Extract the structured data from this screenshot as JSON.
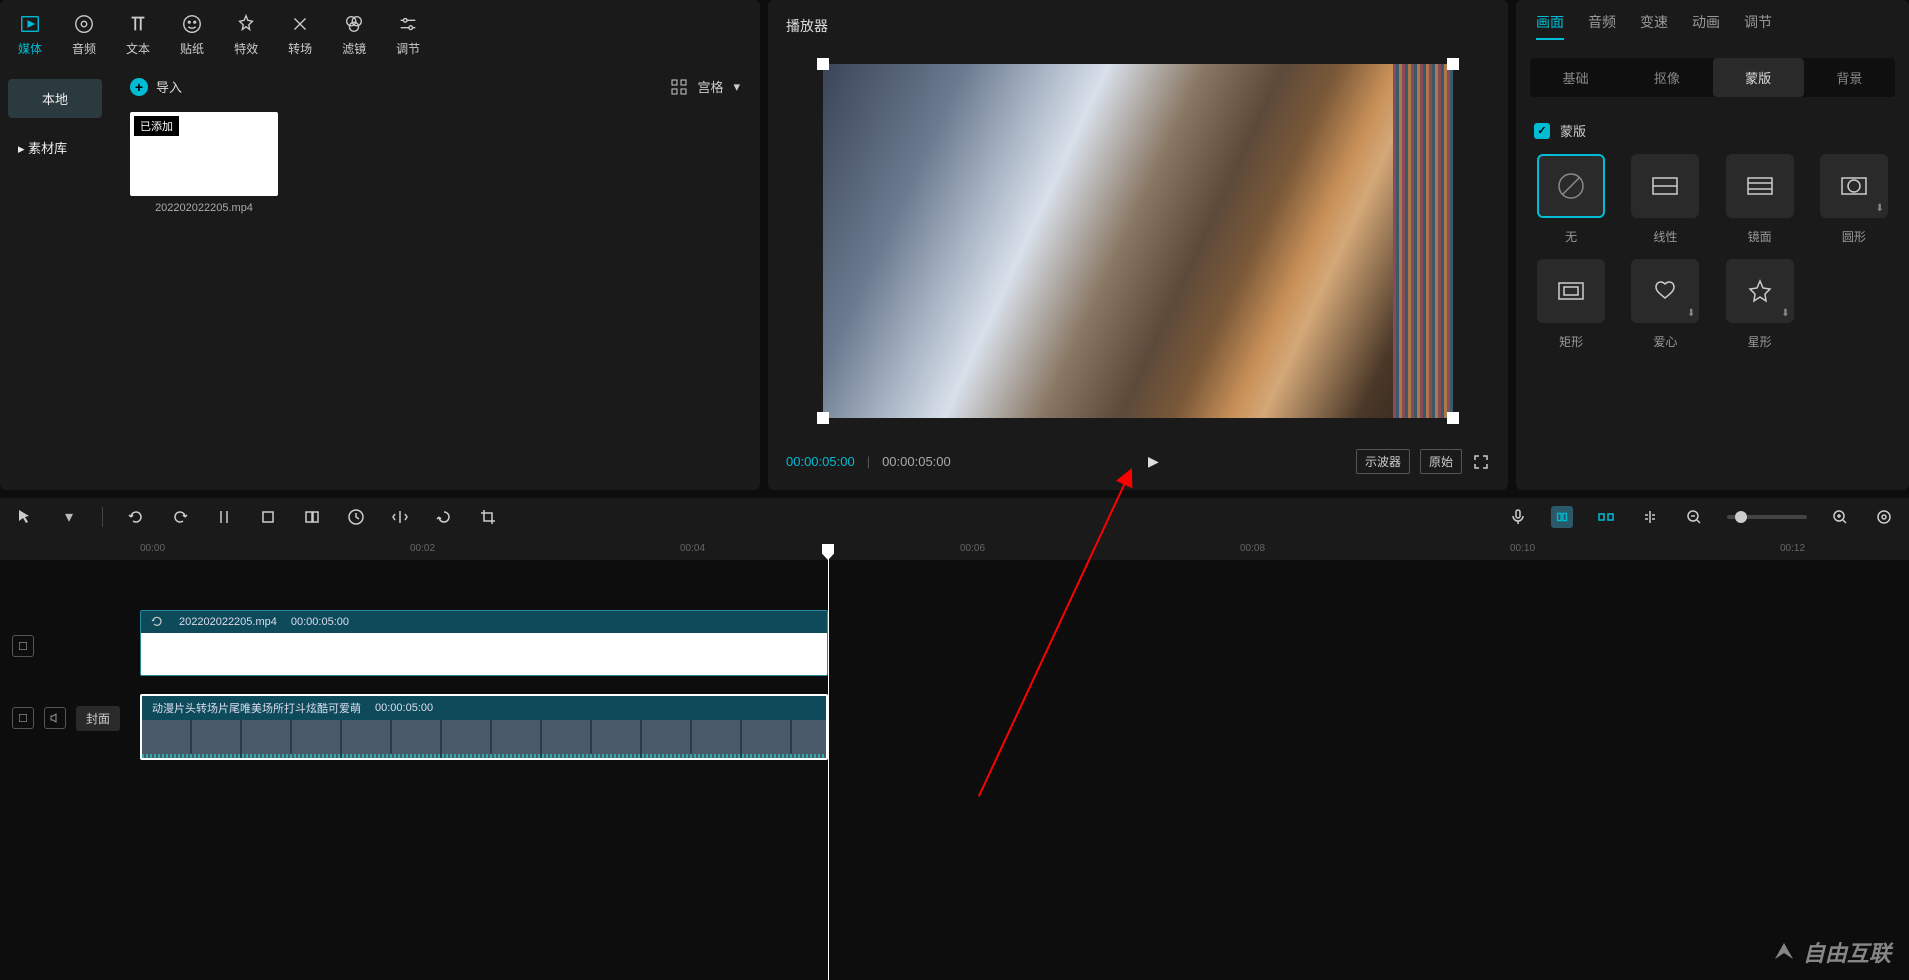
{
  "topNav": {
    "items": [
      {
        "label": "媒体",
        "icon": "media"
      },
      {
        "label": "音频",
        "icon": "audio"
      },
      {
        "label": "文本",
        "icon": "text"
      },
      {
        "label": "贴纸",
        "icon": "sticker"
      },
      {
        "label": "特效",
        "icon": "effect"
      },
      {
        "label": "转场",
        "icon": "transition"
      },
      {
        "label": "滤镜",
        "icon": "filter"
      },
      {
        "label": "调节",
        "icon": "adjust"
      }
    ]
  },
  "mediaSidebar": {
    "local": "本地",
    "library": "素材库"
  },
  "mediaContent": {
    "import": "导入",
    "viewMode": "宫格",
    "thumb": {
      "badge": "已添加",
      "filename": "202202022205.mp4"
    }
  },
  "player": {
    "title": "播放器",
    "currentTime": "00:00:05:00",
    "totalTime": "00:00:05:00",
    "oscilloscope": "示波器",
    "original": "原始"
  },
  "propsPanel": {
    "tabs": [
      "画面",
      "音频",
      "变速",
      "动画",
      "调节"
    ],
    "subtabs": [
      "基础",
      "抠像",
      "蒙版",
      "背景"
    ],
    "maskLabel": "蒙版",
    "maskItems": [
      {
        "name": "无",
        "shape": "none"
      },
      {
        "name": "线性",
        "shape": "linear"
      },
      {
        "name": "镜面",
        "shape": "mirror"
      },
      {
        "name": "圆形",
        "shape": "circle"
      },
      {
        "name": "矩形",
        "shape": "rect"
      },
      {
        "name": "爱心",
        "shape": "heart"
      },
      {
        "name": "星形",
        "shape": "star"
      }
    ]
  },
  "timelineRuler": [
    "00:00",
    "00:02",
    "00:04",
    "00:06",
    "00:08",
    "00:10",
    "00:12"
  ],
  "timeline": {
    "cover": "封面",
    "clip1": {
      "name": "202202022205.mp4",
      "duration": "00:00:05:00"
    },
    "clip2": {
      "name": "动漫片头转场片尾唯美场所打斗炫酷可爱萌",
      "duration": "00:00:05:00"
    }
  },
  "watermark": "自由互联",
  "colors": {
    "accent": "#00bcd4"
  }
}
